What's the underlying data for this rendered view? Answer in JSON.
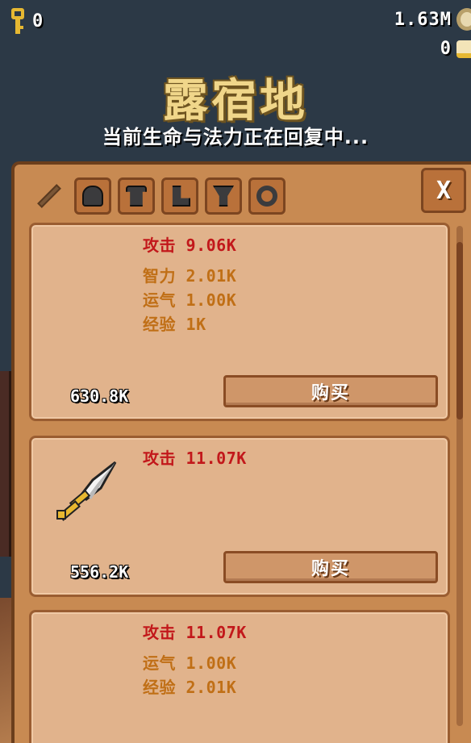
{
  "hud": {
    "keys_count": "0",
    "gold_amount": "1.63M",
    "scrolls_count": "0"
  },
  "header": {
    "title": "露宿地",
    "subtitle": "当前生命与法力正在回复中..."
  },
  "shop": {
    "tabs": [
      {
        "icon": "sword-icon",
        "active": true
      },
      {
        "icon": "helmet-icon",
        "active": false
      },
      {
        "icon": "armor-icon",
        "active": false
      },
      {
        "icon": "boots-icon",
        "active": false
      },
      {
        "icon": "amulet-icon",
        "active": false
      },
      {
        "icon": "ring-icon",
        "active": false
      }
    ],
    "close_label": "X",
    "items": [
      {
        "primary": "攻击 9.06K",
        "stats": [
          "智力 2.01K",
          "运气 1.00K",
          "经验 1K"
        ],
        "price": "630.8K",
        "buy_label": "购买",
        "sprite": "none"
      },
      {
        "primary": "攻击 11.07K",
        "stats": [],
        "price": "556.2K",
        "buy_label": "购买",
        "sprite": "dagger-icon"
      },
      {
        "primary": "攻击 11.07K",
        "stats": [
          "运气 1.00K",
          "经验 2.01K"
        ],
        "price": "",
        "buy_label": "",
        "sprite": "none"
      }
    ]
  },
  "colors": {
    "primary_stat": "#c2181b",
    "secondary_stat": "#c06f16",
    "panel": "#c88a52",
    "card": "#e1b38c",
    "title": "#f0d68a"
  }
}
